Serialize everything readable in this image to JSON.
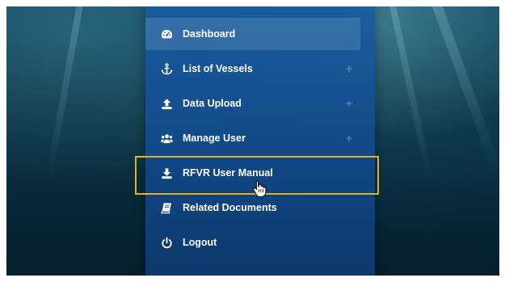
{
  "menu": {
    "items": [
      {
        "label": "Dashboard",
        "icon": "tachometer-icon",
        "has_plus": false,
        "active": true
      },
      {
        "label": "List of Vessels",
        "icon": "anchor-icon",
        "has_plus": true,
        "active": false
      },
      {
        "label": "Data Upload",
        "icon": "upload-icon",
        "has_plus": true,
        "active": false
      },
      {
        "label": "Manage User",
        "icon": "users-icon",
        "has_plus": true,
        "active": false
      },
      {
        "label": "RFVR User Manual",
        "icon": "download-icon",
        "has_plus": false,
        "active": false
      },
      {
        "label": "Related Documents",
        "icon": "book-icon",
        "has_plus": false,
        "active": false
      },
      {
        "label": "Logout",
        "icon": "power-icon",
        "has_plus": false,
        "active": false
      }
    ],
    "plus_glyph": "+"
  },
  "colors": {
    "menu_background": "#185ca0",
    "highlight_border": "#e6b023",
    "text": "#ffffff"
  }
}
